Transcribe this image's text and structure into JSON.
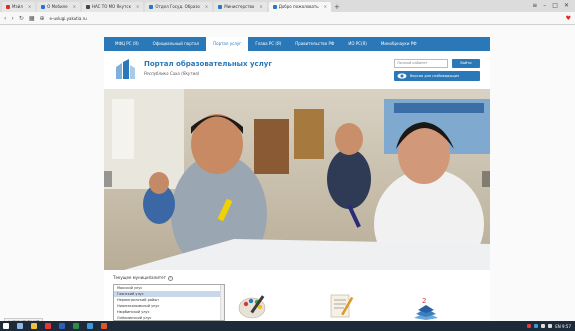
{
  "browser": {
    "tabs": [
      {
        "label": "Мэйл",
        "favicon_color": "#d93025"
      },
      {
        "label": "О Мобиле",
        "favicon_color": "#2b6fd6"
      },
      {
        "label": "НАС ТО МО Якутск",
        "favicon_color": "#444444"
      },
      {
        "label": "Отдел Госуд. Образо",
        "favicon_color": "#2b78b8"
      },
      {
        "label": "Министерство",
        "favicon_color": "#2b78b8"
      },
      {
        "label": "Добро пожаловать",
        "favicon_color": "#2b78b8",
        "active": true
      }
    ],
    "new_tab": "+",
    "url": "e-uslugi.yakutia.ru",
    "window_controls": [
      "≡",
      "–",
      "□",
      "✕"
    ]
  },
  "nav": {
    "items": [
      {
        "label": "МФЦ РС (Я)"
      },
      {
        "label": "Официальный портал"
      },
      {
        "label": "Портал услуг",
        "active": true
      },
      {
        "label": "Глава РС (Я)"
      },
      {
        "label": "Правительство РФ"
      },
      {
        "label": "ИО РС(Я)"
      },
      {
        "label": "Минобрнауки РФ"
      }
    ]
  },
  "header": {
    "title": "Портал образовательных услуг",
    "subtitle": "Республика Саха (Якутия)",
    "cabinet_placeholder": "Личный кабинет",
    "login_button": "Войти",
    "vision_button": "Версия для слабовидящих"
  },
  "colors": {
    "brand": "#2b78b8",
    "nav_text": "#ffffff"
  },
  "municipality": {
    "label": "Текущее муниципалитет",
    "help": "?",
    "options": [
      {
        "label": "Мокский улус"
      },
      {
        "label": "Гаянский улус",
        "selected": true
      },
      {
        "label": "Нерюнгринский район"
      },
      {
        "label": "Нижнеколымский улус"
      },
      {
        "label": "Нюрбинский улус"
      },
      {
        "label": "Олёкминский улус"
      }
    ]
  },
  "services": [
    {
      "icon": "palette-icon"
    },
    {
      "icon": "certificate-icon"
    },
    {
      "icon": "books-icon"
    }
  ],
  "status_tip": "e-uslugi.yakutia.ru/#",
  "taskbar": {
    "tray_text": "EN  9:57",
    "icons": [
      "windows-icon",
      "search-icon",
      "folder-icon",
      "browser-icon",
      "word-icon",
      "excel-icon",
      "edge-icon",
      "media-icon"
    ]
  }
}
